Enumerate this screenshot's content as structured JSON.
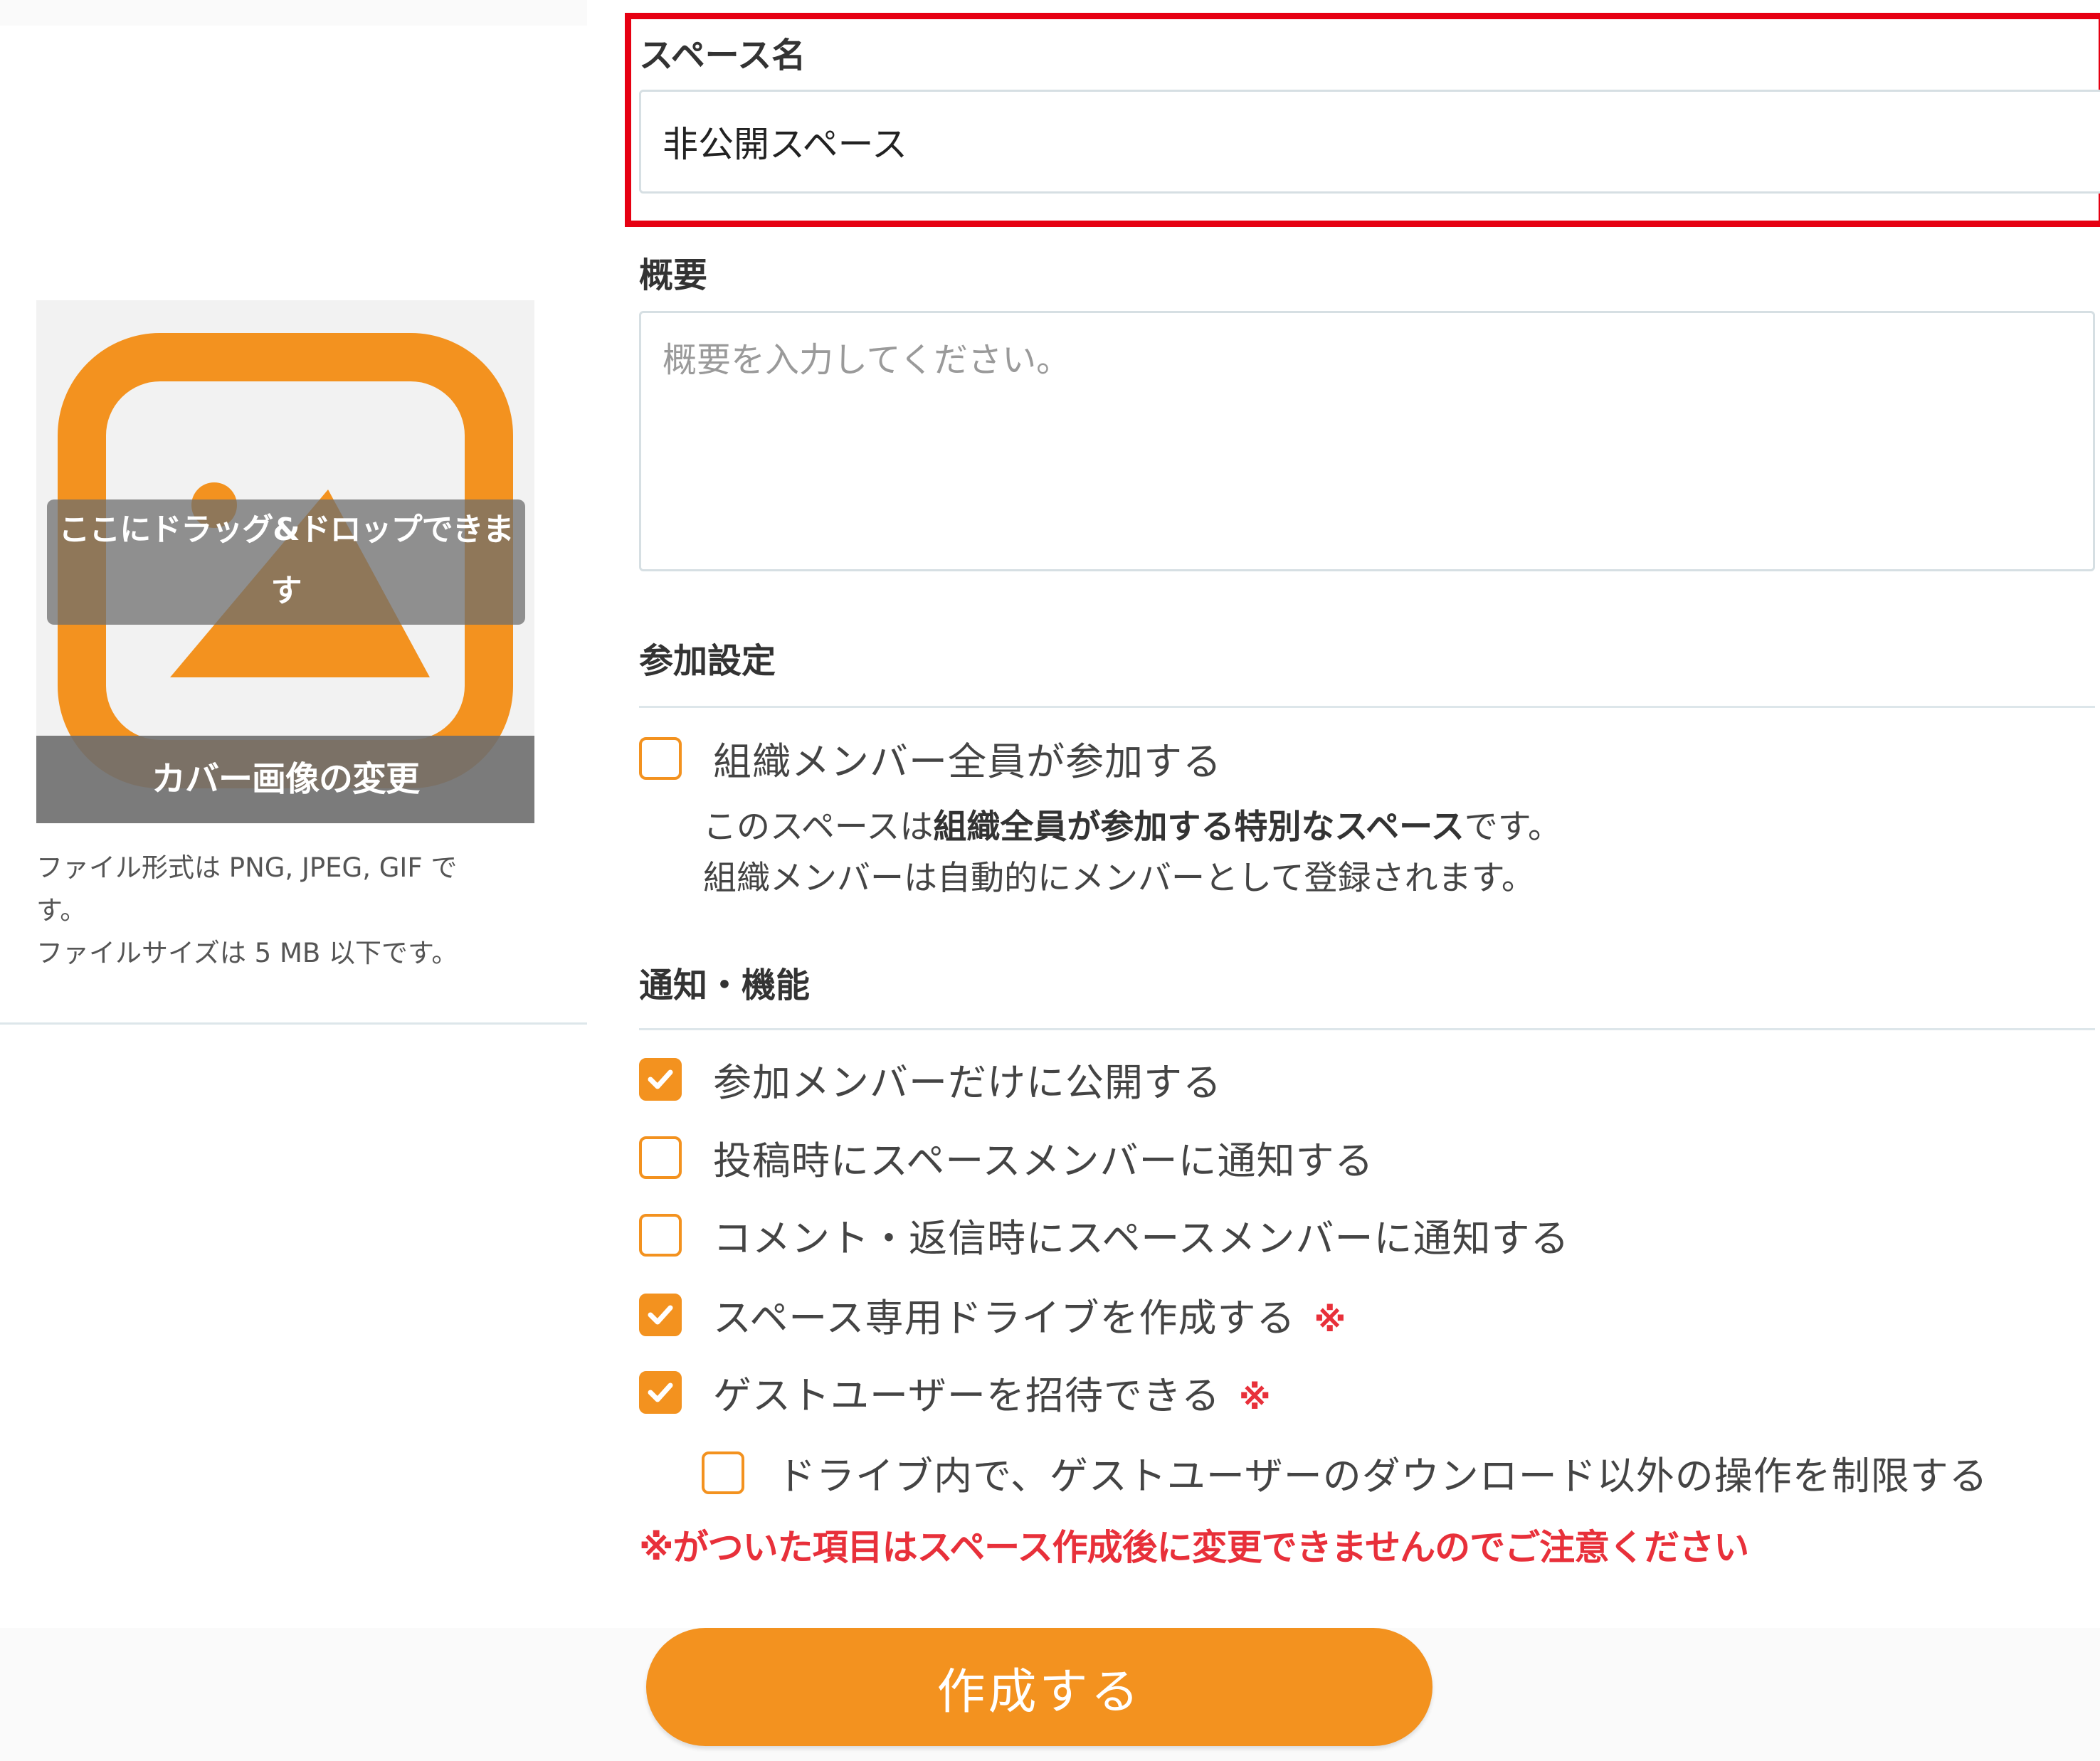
{
  "cover": {
    "dnd_text": "ここにドラッグ&ドロップできま\nす",
    "change_label": "カバー画像の変更",
    "file_note": "ファイル形式は PNG, JPEG, GIF で\nす。\nファイルサイズは 5 MB 以下です。",
    "icon": "image-icon",
    "accent": "#f3921f"
  },
  "space_name": {
    "label": "スペース名",
    "value": "非公開スペース"
  },
  "summary": {
    "label": "概要",
    "placeholder": "概要を入力してください。"
  },
  "participation": {
    "heading": "参加設定",
    "all_members": {
      "label": "組織メンバー全員が参加する",
      "checked": false
    },
    "desc_line1_pre": "このスペースは",
    "desc_line1_bold": "組織全員が参加する特別なスペース",
    "desc_line1_post": "です。",
    "desc_line2": "組織メンバーは自動的にメンバーとして登録されます。"
  },
  "features": {
    "heading": "通知・機能",
    "options": [
      {
        "label": "参加メンバーだけに公開する",
        "checked": true
      },
      {
        "label": "投稿時にスペースメンバーに通知する",
        "checked": false
      },
      {
        "label": "コメント・返信時にスペースメンバーに通知する",
        "checked": false
      },
      {
        "label": "スペース専用ドライブを作成する",
        "checked": true,
        "mark": "※"
      },
      {
        "label": "ゲストユーザーを招待できる",
        "checked": true,
        "mark": "※"
      },
      {
        "label": "ドライブ内で、ゲストユーザーのダウンロード以外の操作を制限する",
        "checked": false
      }
    ],
    "warning": "※がついた項目はスペース作成後に変更できませんのでご注意ください"
  },
  "create_button": {
    "label": "作成する"
  },
  "colors": {
    "accent": "#f3921f",
    "highlight": "#e60012",
    "warning": "#e8303a"
  }
}
